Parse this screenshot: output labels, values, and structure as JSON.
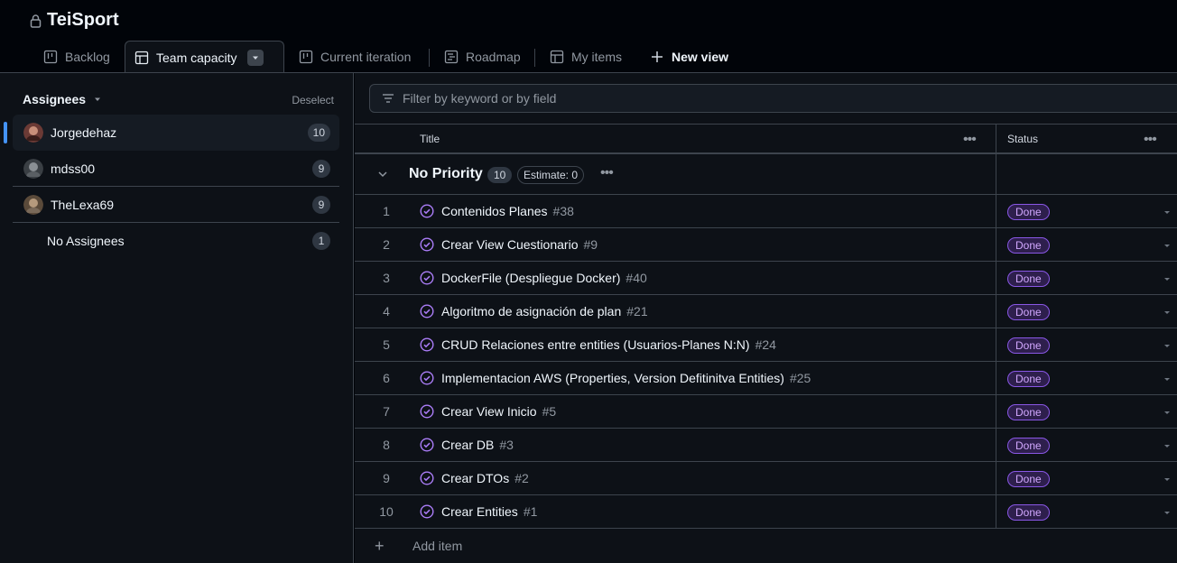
{
  "project": {
    "title": "TeiSport"
  },
  "tabs": [
    {
      "label": "Backlog",
      "icon": "board-icon"
    },
    {
      "label": "Team capacity",
      "icon": "table-icon",
      "active": true
    },
    {
      "label": "Current iteration",
      "icon": "board-icon"
    },
    {
      "label": "Roadmap",
      "icon": "roadmap-icon"
    },
    {
      "label": "My items",
      "icon": "table-icon"
    },
    {
      "label": "New view",
      "icon": "plus-icon"
    }
  ],
  "sidebar": {
    "heading": "Assignees",
    "deselect": "Deselect",
    "items": [
      {
        "name": "Jorgedehaz",
        "count": "10",
        "selected": true
      },
      {
        "name": "mdss00",
        "count": "9"
      },
      {
        "name": "TheLexa69",
        "count": "9"
      },
      {
        "name": "No Assignees",
        "count": "1"
      }
    ]
  },
  "main": {
    "filter_placeholder": "Filter by keyword or by field",
    "columns": {
      "title": "Title",
      "status": "Status"
    },
    "group": {
      "name": "No Priority",
      "count": "10",
      "estimate": "Estimate: 0"
    },
    "rows": [
      {
        "num": "1",
        "title": "Contenidos Planes",
        "ref": "#38",
        "status": "Done"
      },
      {
        "num": "2",
        "title": "Crear View Cuestionario",
        "ref": "#9",
        "status": "Done"
      },
      {
        "num": "3",
        "title": "DockerFile (Despliegue Docker)",
        "ref": "#40",
        "status": "Done"
      },
      {
        "num": "4",
        "title": "Algoritmo de asignación de plan",
        "ref": "#21",
        "status": "Done"
      },
      {
        "num": "5",
        "title": "CRUD Relaciones entre entities (Usuarios-Planes N:N)",
        "ref": "#24",
        "status": "Done"
      },
      {
        "num": "6",
        "title": "Implementacion AWS (Properties, Version Defitinitva Entities)",
        "ref": "#25",
        "status": "Done"
      },
      {
        "num": "7",
        "title": "Crear View Inicio",
        "ref": "#5",
        "status": "Done"
      },
      {
        "num": "8",
        "title": "Crear DB",
        "ref": "#3",
        "status": "Done"
      },
      {
        "num": "9",
        "title": "Crear DTOs",
        "ref": "#2",
        "status": "Done"
      },
      {
        "num": "10",
        "title": "Crear Entities",
        "ref": "#1",
        "status": "Done"
      }
    ],
    "add_item": "Add item"
  },
  "colors": {
    "done_fg": "#d2a8ff",
    "done_bg": "#2e1f4d",
    "accent": "#4493f8",
    "closed_icon": "#ab7df8"
  }
}
